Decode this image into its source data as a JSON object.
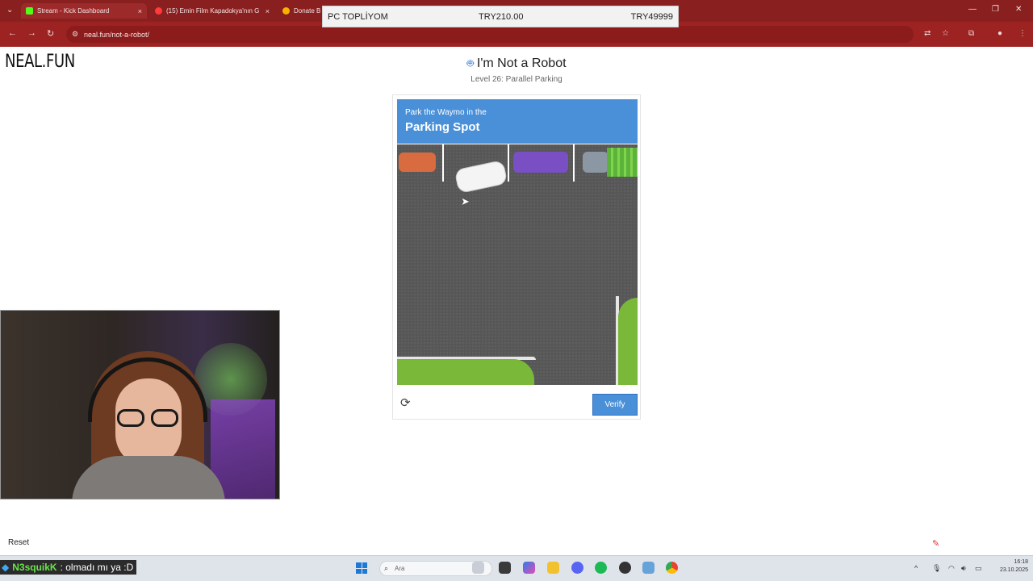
{
  "browser": {
    "tabs": [
      {
        "label": "Stream - Kick Dashboard",
        "fav_color": "#53fc18",
        "active": true
      },
      {
        "label": "(15) Emin Film Kapadokya'nın G",
        "fav_color": "#ff3b3b",
        "active": false
      },
      {
        "label": "Donate B",
        "fav_color": "#f5b200",
        "active": false
      }
    ],
    "close_glyph": "×",
    "url": "neal.fun/not-a-robot/"
  },
  "price_overlay": {
    "left": "PC TOPLİYOM",
    "mid": "TRY210.00",
    "right": "TRY49999"
  },
  "site": {
    "logo": "NEAL.FUN"
  },
  "page": {
    "title": "I'm Not a Robot",
    "subtitle": "Level 26: Parallel Parking"
  },
  "captcha": {
    "instruction_small": "Park the Waymo in the",
    "instruction_big": "Parking Spot",
    "verify_label": "Verify",
    "colors": {
      "header": "#4a90d9",
      "asphalt": "#575757",
      "grass": "#7ab83a"
    }
  },
  "footer": {
    "reset_label": "Reset"
  },
  "stream_chat": {
    "user": "N3squikK",
    "message": ": olmadı mı ya :D"
  },
  "taskbar": {
    "search_placeholder": "Ara",
    "time": "16:18",
    "date": "23.10.2025"
  }
}
